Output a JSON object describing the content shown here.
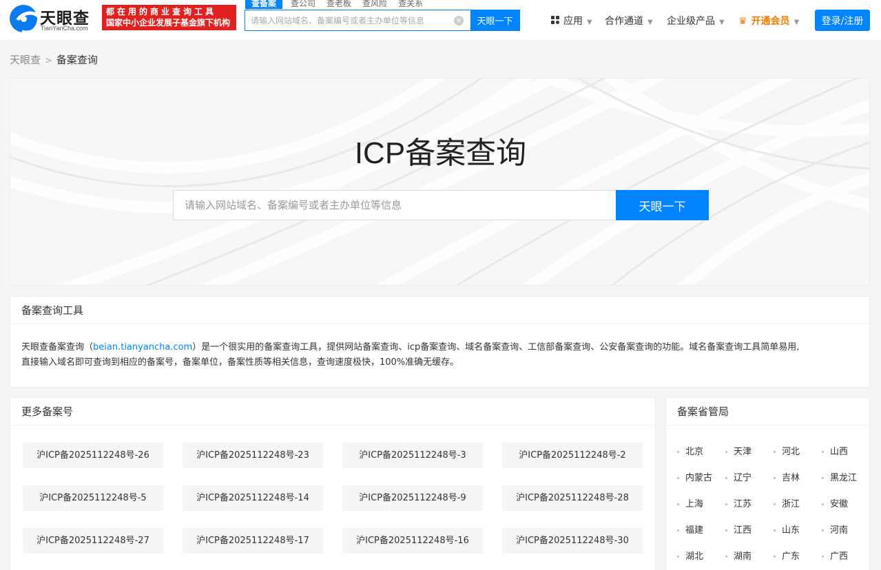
{
  "header": {
    "logo_name": "天眼查",
    "logo_domain": "TianYanCha.com",
    "slogan_line1": "都在用的商业查询工具",
    "slogan_line2": "国家中小企业发展子基金旗下机构",
    "search_tabs": [
      {
        "label": "查备案",
        "active": true
      },
      {
        "label": "查公司"
      },
      {
        "label": "查老板"
      },
      {
        "label": "查风险"
      },
      {
        "label": "查关系"
      }
    ],
    "search_placeholder": "请输入网站域名、备案编号或者主办单位等信息",
    "search_button": "天眼一下",
    "nav_apps": "应用",
    "nav_cooperation": "合作通道",
    "nav_enterprise": "企业级产品",
    "nav_vip": "开通会员",
    "login_button": "登录/注册"
  },
  "breadcrumb": {
    "home": "天眼查",
    "current": "备案查询"
  },
  "hero": {
    "title": "ICP备案查询",
    "search_placeholder": "请输入网站域名、备案编号或者主办单位等信息",
    "search_button": "天眼一下"
  },
  "tools": {
    "title": "备案查询工具",
    "desc_prefix": "天眼查备案查询（",
    "desc_link": "beian.tianyancha.com",
    "desc_line1_rest": "）是一个很实用的备案查询工具，提供网站备案查询、icp备案查询、域名备案查询、工信部备案查询、公安备案查询的功能。域名备案查询工具简单易用,",
    "desc_line2": "直接输入域名即可查询到相应的备案号，备案单位，备案性质等相关信息，查询速度极快，100%准确无缓存。"
  },
  "more_numbers": {
    "title": "更多备案号",
    "items": [
      "沪ICP备2025112248号-26",
      "沪ICP备2025112248号-23",
      "沪ICP备2025112248号-3",
      "沪ICP备2025112248号-2",
      "沪ICP备2025112248号-5",
      "沪ICP备2025112248号-14",
      "沪ICP备2025112248号-9",
      "沪ICP备2025112248号-28",
      "沪ICP备2025112248号-27",
      "沪ICP备2025112248号-17",
      "沪ICP备2025112248号-16",
      "沪ICP备2025112248号-30"
    ]
  },
  "provinces": {
    "title": "备案省管局",
    "items": [
      "北京",
      "天津",
      "河北",
      "山西",
      "内蒙古",
      "辽宁",
      "吉林",
      "黑龙江",
      "上海",
      "江苏",
      "浙江",
      "安徽",
      "福建",
      "江西",
      "山东",
      "河南",
      "湖北",
      "湖南",
      "广东",
      "广西"
    ]
  },
  "colors": {
    "brand_blue": "#0084ff",
    "slogan_red": "#e0211f",
    "vip_orange": "#f07d00",
    "page_background": "#f4f5f7"
  },
  "icons": [
    "apps-icon",
    "crown-icon",
    "clear-icon",
    "chevron-right-icon",
    "caret-down-icon"
  ]
}
